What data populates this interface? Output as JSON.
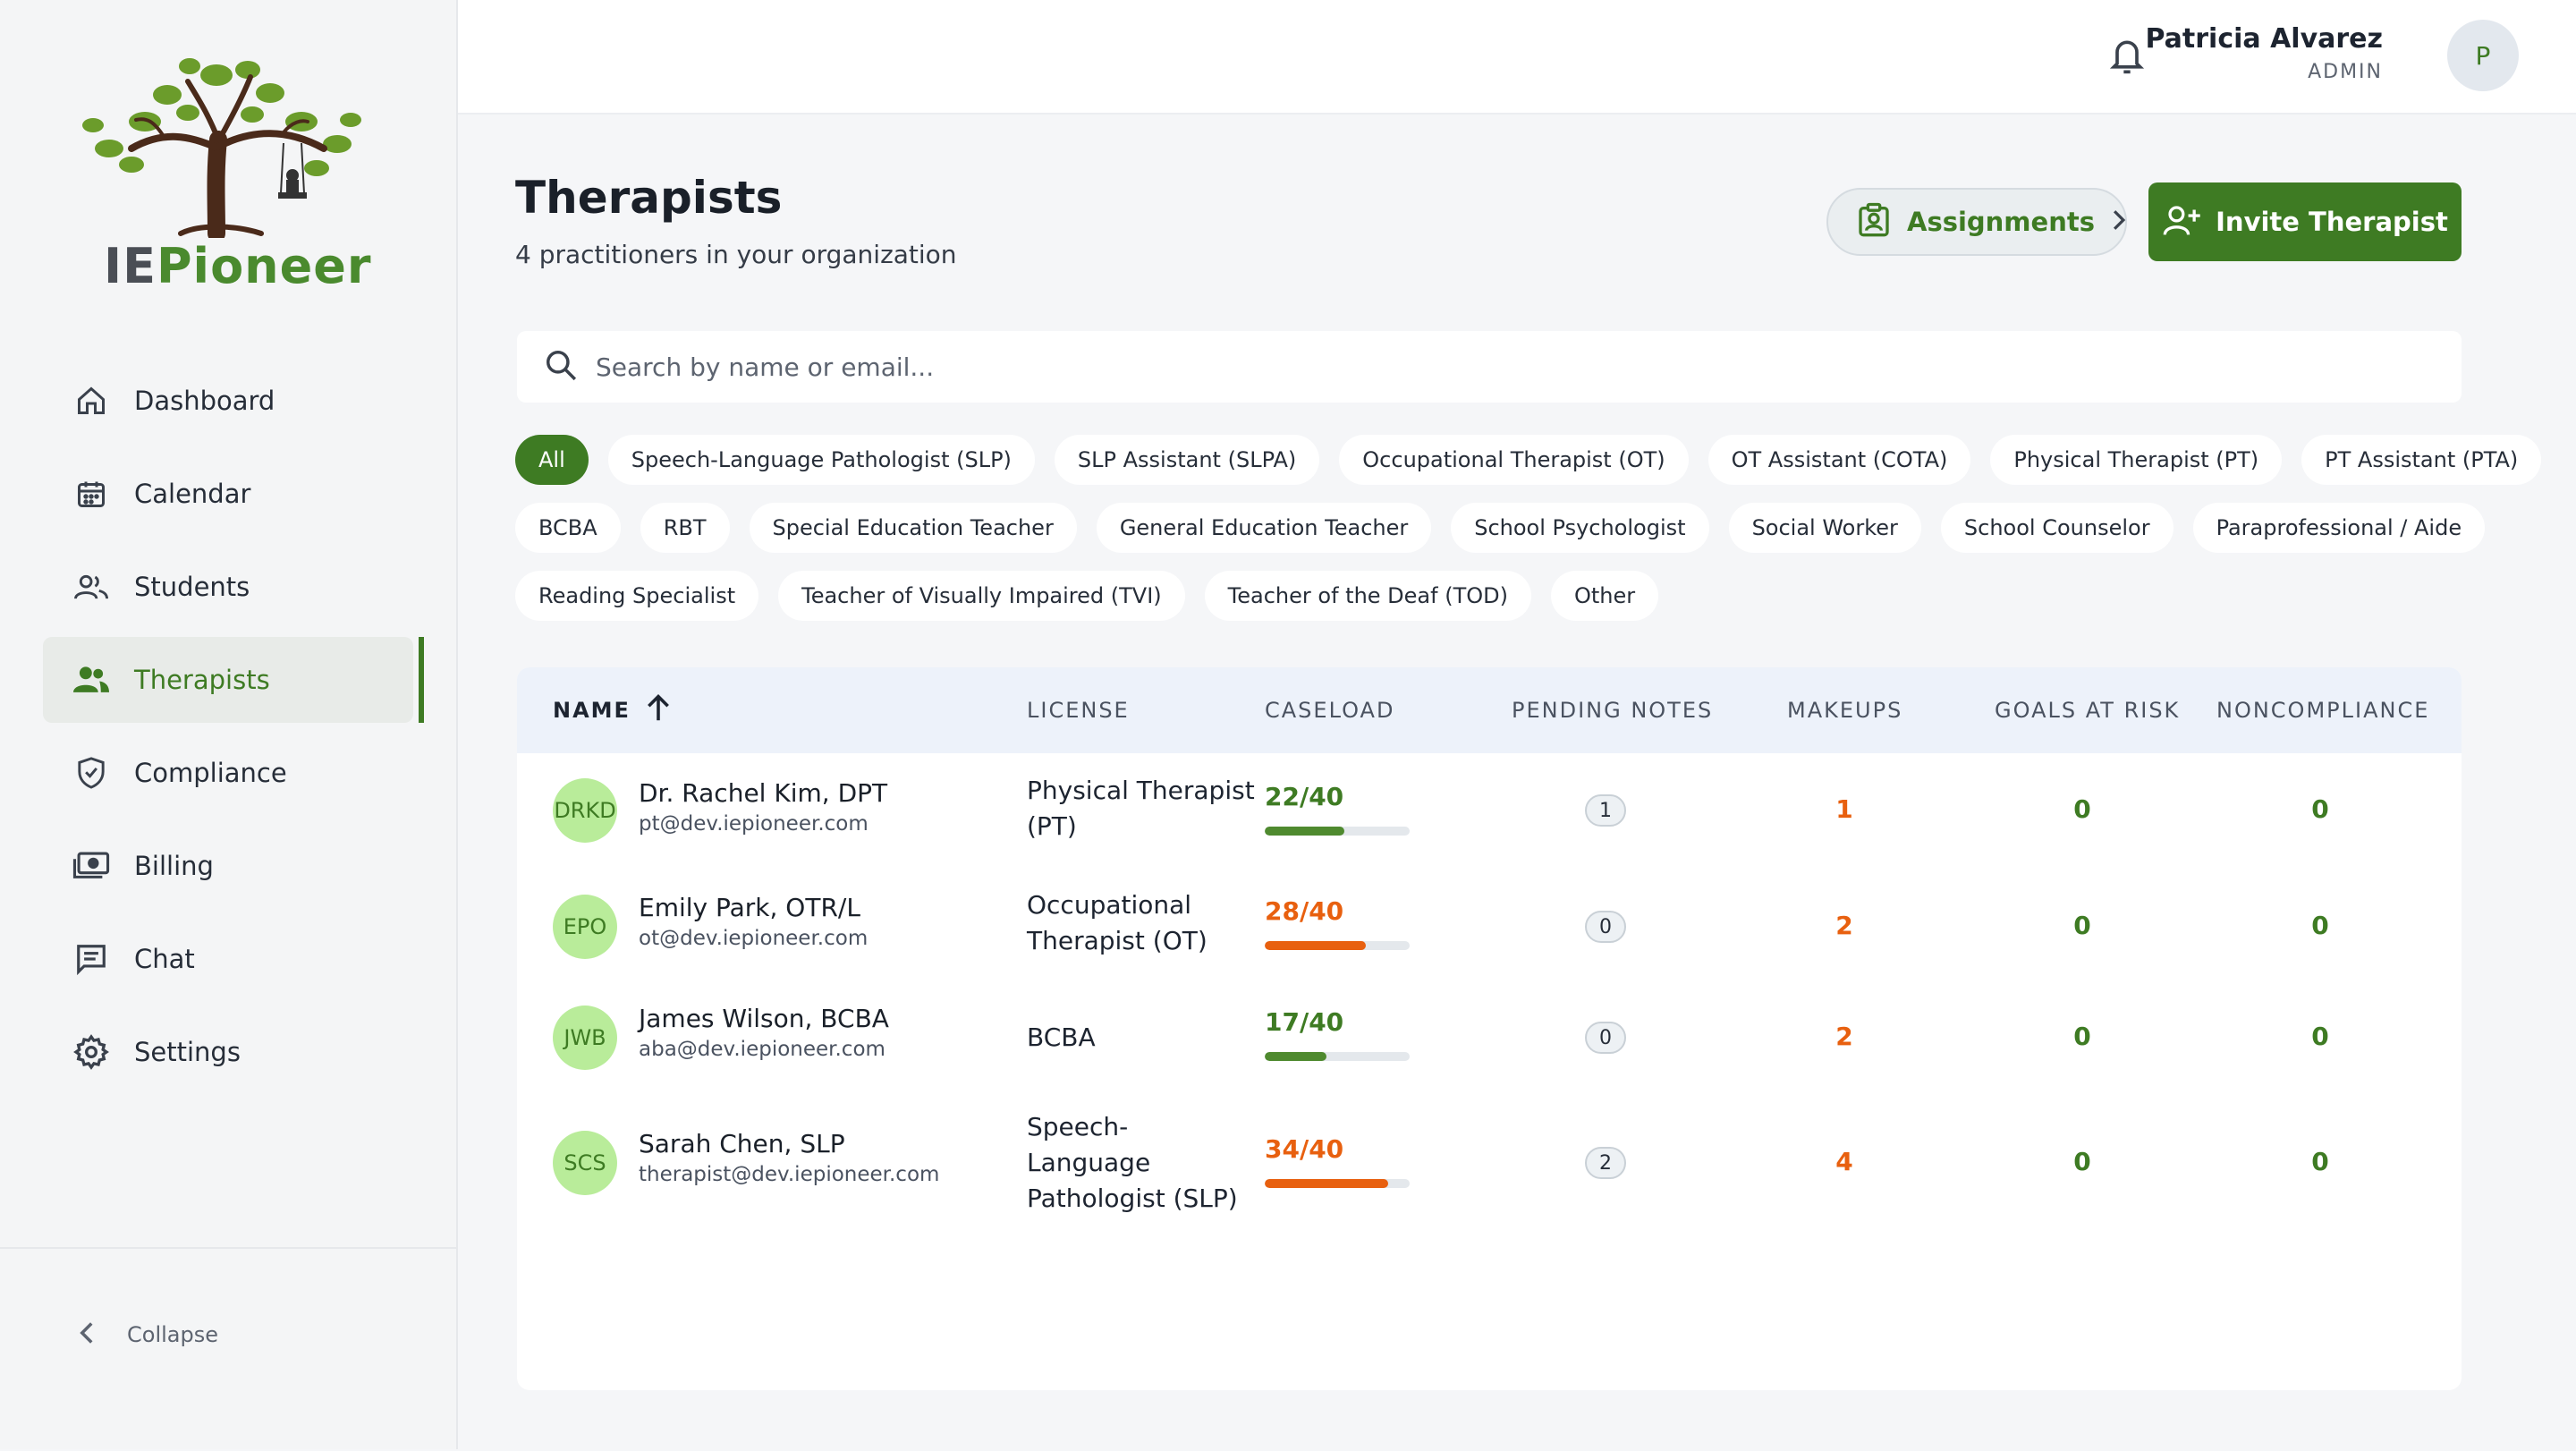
{
  "brand": {
    "name_part1": "IE",
    "name_part2": "Pioneer"
  },
  "sidebar": {
    "items": [
      {
        "label": "Dashboard",
        "icon": "home-icon"
      },
      {
        "label": "Calendar",
        "icon": "calendar-icon"
      },
      {
        "label": "Students",
        "icon": "students-icon"
      },
      {
        "label": "Therapists",
        "icon": "therapists-icon",
        "active": true
      },
      {
        "label": "Compliance",
        "icon": "shield-icon"
      },
      {
        "label": "Billing",
        "icon": "billing-icon"
      },
      {
        "label": "Chat",
        "icon": "chat-icon"
      },
      {
        "label": "Settings",
        "icon": "gear-icon"
      }
    ],
    "collapse_label": "Collapse"
  },
  "header": {
    "user_name": "Patricia Alvarez",
    "user_role": "ADMIN",
    "avatar_initial": "P"
  },
  "page": {
    "title": "Therapists",
    "subtitle": "4 practitioners in your organization",
    "assignments_label": "Assignments",
    "invite_label": "Invite Therapist"
  },
  "search": {
    "placeholder": "Search by name or email...",
    "value": ""
  },
  "filters": {
    "row1": [
      "All",
      "Speech-Language Pathologist (SLP)",
      "SLP Assistant (SLPA)",
      "Occupational Therapist (OT)",
      "OT Assistant (COTA)",
      "Physical Therapist (PT)",
      "PT Assistant (PTA)"
    ],
    "row2": [
      "BCBA",
      "RBT",
      "Special Education Teacher",
      "General Education Teacher",
      "School Psychologist",
      "Social Worker",
      "School Counselor",
      "Paraprofessional / Aide"
    ],
    "row3": [
      "Reading Specialist",
      "Teacher of Visually Impaired (TVI)",
      "Teacher of the Deaf (TOD)",
      "Other"
    ],
    "active": "All"
  },
  "table": {
    "headers": {
      "name": "NAME",
      "license": "LICENSE",
      "caseload": "CASELOAD",
      "pending": "PENDING NOTES",
      "makeups": "MAKEUPS",
      "goals": "GOALS AT RISK",
      "noncompliance": "NONCOMPLIANCE"
    },
    "rows": [
      {
        "initials": "DRKD",
        "name": "Dr. Rachel Kim, DPT",
        "email": "pt@dev.iepioneer.com",
        "license": "Physical Therapist (PT)",
        "caseload": "22/40",
        "caseload_fraction": 0.55,
        "caseload_status": "ok",
        "pending": "1",
        "makeups": "1",
        "goals": "0",
        "noncompliance": "0"
      },
      {
        "initials": "EPO",
        "name": "Emily Park, OTR/L",
        "email": "ot@dev.iepioneer.com",
        "license": "Occupational Therapist (OT)",
        "caseload": "28/40",
        "caseload_fraction": 0.7,
        "caseload_status": "high",
        "pending": "0",
        "makeups": "2",
        "goals": "0",
        "noncompliance": "0"
      },
      {
        "initials": "JWB",
        "name": "James Wilson, BCBA",
        "email": "aba@dev.iepioneer.com",
        "license": "BCBA",
        "caseload": "17/40",
        "caseload_fraction": 0.425,
        "caseload_status": "ok",
        "pending": "0",
        "makeups": "2",
        "goals": "0",
        "noncompliance": "0"
      },
      {
        "initials": "SCS",
        "name": "Sarah Chen, SLP",
        "email": "therapist@dev.iepioneer.com",
        "license": "Speech-Language Pathologist (SLP)",
        "caseload": "34/40",
        "caseload_fraction": 0.85,
        "caseload_status": "high",
        "pending": "2",
        "makeups": "4",
        "goals": "0",
        "noncompliance": "0"
      }
    ]
  },
  "colors": {
    "accent": "#3e7b23",
    "warning": "#e8600f",
    "ok_bar": "#4f8a2f",
    "avatar_bg": "#b9ec9a"
  }
}
